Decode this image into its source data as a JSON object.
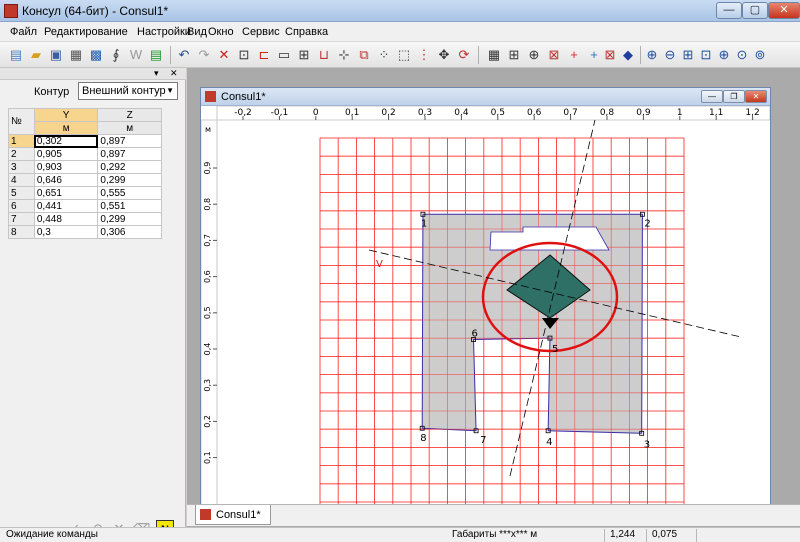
{
  "window": {
    "title": "Консул (64-бит) - Consul1*",
    "min": "—",
    "max": "▢",
    "close": "✕"
  },
  "menu": [
    "Файл",
    "Редактирование",
    "Настройки",
    "Вид",
    "Окно",
    "Сервис",
    "Справка"
  ],
  "left_panel": {
    "contour_label": "Контур",
    "contour_value": "Внешний контур",
    "table": {
      "headers": [
        "№",
        "Y",
        "Z"
      ],
      "units": [
        "",
        "м",
        "м"
      ],
      "rows": [
        {
          "n": "1",
          "y": "0,302",
          "z": "0,897"
        },
        {
          "n": "2",
          "y": "0,905",
          "z": "0,897"
        },
        {
          "n": "3",
          "y": "0,903",
          "z": "0,292"
        },
        {
          "n": "4",
          "y": "0,646",
          "z": "0,299"
        },
        {
          "n": "5",
          "y": "0,651",
          "z": "0,555"
        },
        {
          "n": "6",
          "y": "0,441",
          "z": "0,551"
        },
        {
          "n": "7",
          "y": "0,448",
          "z": "0,299"
        },
        {
          "n": "8",
          "y": "0,3",
          "z": "0,306"
        }
      ]
    },
    "bottom_n": "N"
  },
  "document": {
    "title": "Consul1*",
    "tab": "Consul1*",
    "axis_unit": "м",
    "top_ruler": [
      "-0,2",
      "-0,1",
      "0",
      "0,1",
      "0,2",
      "0,3",
      "0,4",
      "0,5",
      "0,6",
      "0,7",
      "0,8",
      "0,9",
      "1",
      "1,1",
      "1,2"
    ],
    "left_ruler": [
      "0,9",
      "0,8",
      "0,7",
      "0,6",
      "0,5",
      "0,4",
      "0,3",
      "0,2",
      "0,1"
    ],
    "vertex_labels": [
      "1",
      "2",
      "3",
      "4",
      "5",
      "6",
      "7",
      "8"
    ],
    "axis_letter": "V"
  },
  "status": {
    "message": "Ожидание команды",
    "dims_label": "Габариты ***x*** м",
    "coord_y": "1,244",
    "coord_z": "0,075"
  },
  "colors": {
    "grid": "#ff3030",
    "section_fill": "#c8c8c8",
    "outline": "#3b2ca8",
    "ellipse": "#e01010",
    "kern": "#2e6f66"
  }
}
